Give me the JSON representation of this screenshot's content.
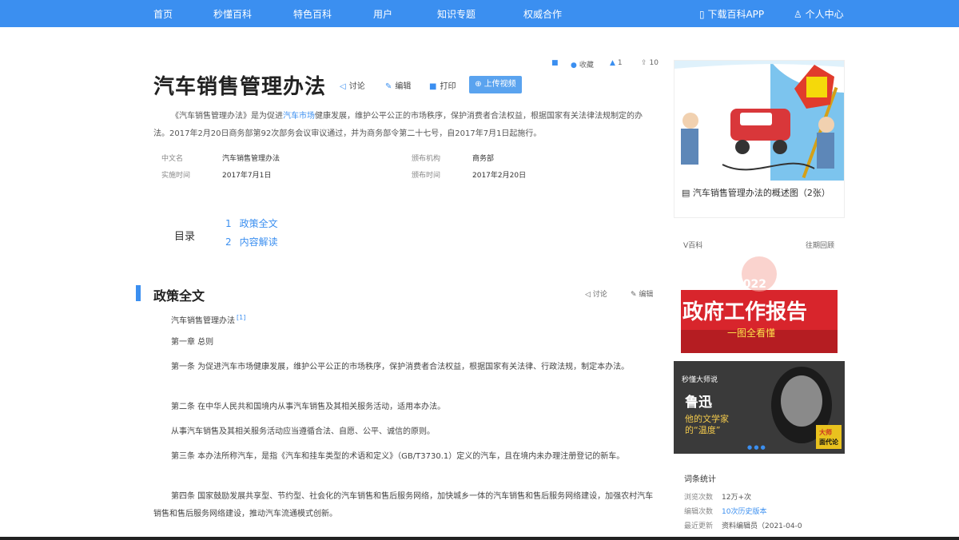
{
  "nav": {
    "items": [
      "首页",
      "秒懂百科",
      "特色百科",
      "用户",
      "知识专题",
      "权威合作"
    ],
    "download_app": "下载百科APP",
    "user_center": "个人中心"
  },
  "article": {
    "title": "汽车销售管理办法",
    "tools": {
      "collect": "收藏",
      "like_count": "1",
      "share_count": "10",
      "discuss": "讨论",
      "edit": "编辑",
      "print": "打印",
      "upload_video": "上传视频"
    },
    "summary_parts": [
      "《汽车销售管理办法》是为促进",
      "汽车市场",
      "健康发展，维护公平公正的市场秩序，保护消费者合法权益，根据国家有关法律法规制定的办法。2017年2月20日商务部第92次部务会议审议通过，并为商务部令第二十七号，自2017年7月1日起施行。"
    ],
    "info": {
      "name_label": "中文名",
      "name_value": "汽车销售管理办法",
      "pub_org_label": "颁布机构",
      "pub_org_value": "商务部",
      "effective_label": "实施时间",
      "effective_value": "2017年7月1日",
      "pub_date_label": "颁布时间",
      "pub_date_value": "2017年2月20日"
    },
    "toc": {
      "label": "目录",
      "items": [
        {
          "num": "1",
          "label": "政策全文"
        },
        {
          "num": "2",
          "label": "内容解读"
        }
      ]
    },
    "section": {
      "title": "政策全文",
      "discuss": "讨论",
      "edit": "编辑",
      "doc_title": "汽车销售管理办法",
      "ref": "[1]",
      "chapter": "第一章 总则",
      "paragraphs": [
        "第一条 为促进汽车市场健康发展，维护公平公正的市场秩序，保护消费者合法权益，根据国家有关法律、行政法规，制定本办法。",
        "第二条 在中华人民共和国境内从事汽车销售及其相关服务活动，适用本办法。",
        "从事汽车销售及其相关服务活动应当遵循合法、自愿、公平、诚信的原则。",
        "第三条 本办法所称汽车，是指《汽车和挂车类型的术语和定义》（GB/T3730.1）定义的汽车，且在境内未办理注册登记的新车。",
        "第四条 国家鼓励发展共享型、节约型、社会化的汽车销售和售后服务网络，加快城乡一体的汽车销售和售后服务网络建设，加强农村汽车销售和售后服务网络建设，推动汽车流通模式创新。"
      ]
    }
  },
  "sidebar": {
    "album_caption": "汽车销售管理办法的概述图（2张）",
    "album_sign_text": "汽车销售管理办法",
    "v_title": "V百科",
    "v_more": "往期回顾",
    "video1": {
      "year": "2022",
      "title": "政府工作报告",
      "subtitle": "一图全看懂"
    },
    "video2": {
      "brand": "秒懂大师说",
      "name": "鲁迅",
      "line1": "他的文学家",
      "line2": "的“温度”",
      "badge1": "大师",
      "badge2": "面代论"
    },
    "stats": {
      "title": "词条统计",
      "views_label": "浏览次数",
      "views_value": "12万+次",
      "edits_label": "编辑次数",
      "edits_value": "10次历史版本",
      "updated_label": "最近更新",
      "updated_value": "资料编辑员（2021-04-0"
    }
  },
  "colors": {
    "nav_bg": "#3b8ff0",
    "accent": "#3b8ff0",
    "upload_btn": "#5aa3ef"
  }
}
